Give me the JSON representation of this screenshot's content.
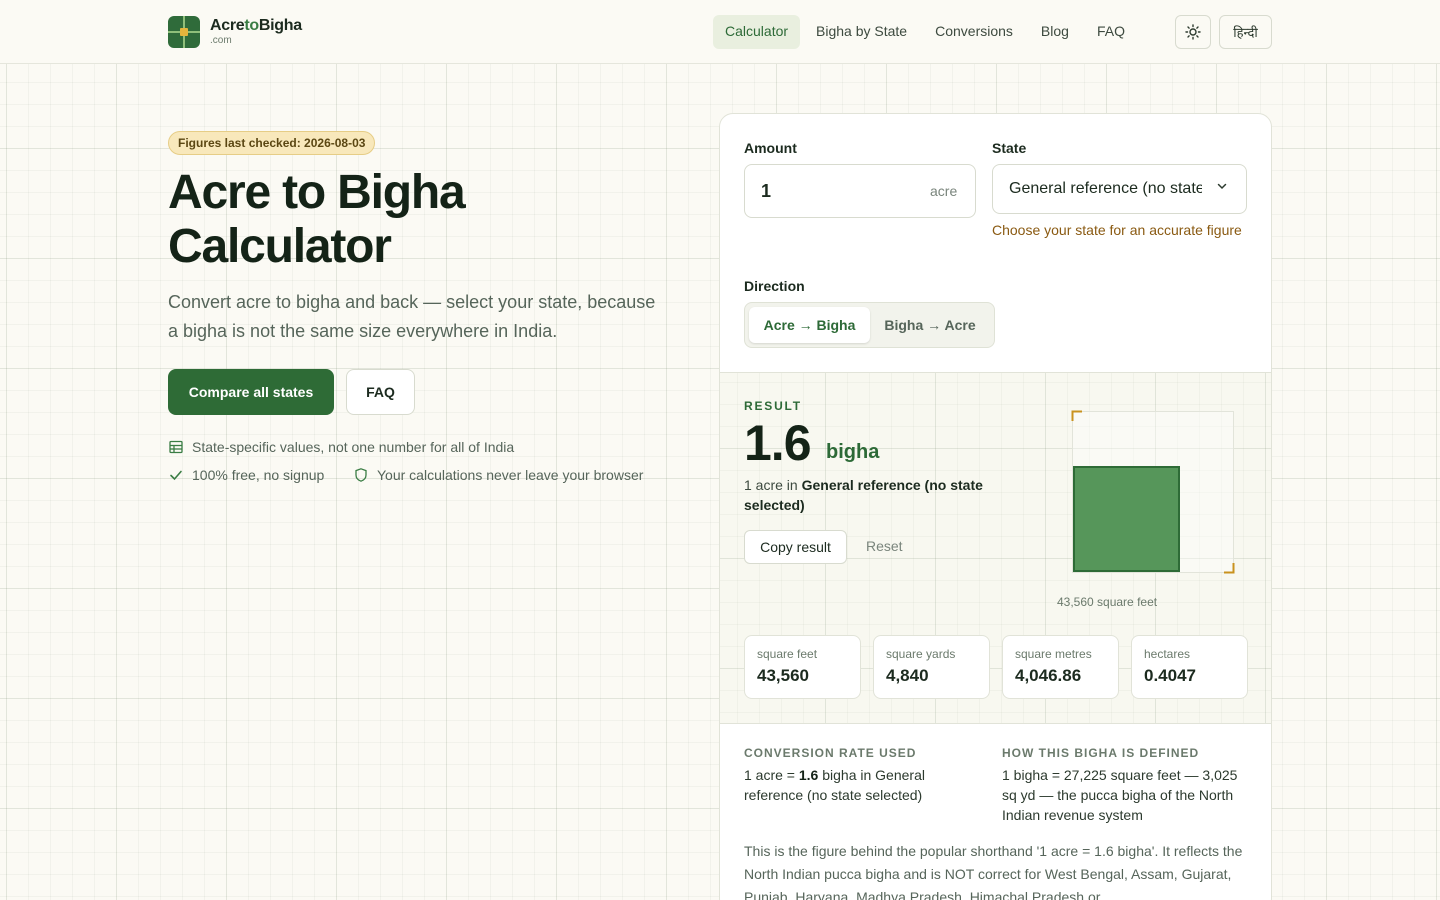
{
  "header": {
    "logo_pre": "Acre",
    "logo_to": "to",
    "logo_post": "Bigha",
    "logo_sub": ".com",
    "nav": [
      "Calculator",
      "Bigha by State",
      "Conversions",
      "Blog",
      "FAQ"
    ],
    "lang": "हिन्दी"
  },
  "hero": {
    "badge": "Figures last checked: 2026-08-03",
    "title": "Acre to Bigha Calculator",
    "subtitle": "Convert acre to bigha and back — select your state, because a bigha is not the same size everywhere in India.",
    "primary_button": "Compare all states",
    "secondary_button": "FAQ",
    "features": [
      "State-specific values, not one number for all of India",
      "100% free, no signup",
      "Your calculations never leave your browser"
    ]
  },
  "calculator": {
    "amount_label": "Amount",
    "amount_value": "1",
    "amount_unit": "acre",
    "state_label": "State",
    "state_value": "General reference (no state selected)",
    "state_hint": "Choose your state for an accurate figure",
    "direction_label": "Direction",
    "direction_options": [
      "Acre → Bigha",
      "Bigha → Acre"
    ]
  },
  "result": {
    "label": "RESULT",
    "value": "1.6",
    "unit": "bigha",
    "desc_prefix": "1 acre in ",
    "desc_state": "General reference (no state selected)",
    "copy_button": "Copy result",
    "reset_button": "Reset",
    "area_caption": "43,560 square feet",
    "stats": [
      {
        "label": "square feet",
        "value": "43,560"
      },
      {
        "label": "square yards",
        "value": "4,840"
      },
      {
        "label": "square metres",
        "value": "4,046.86"
      },
      {
        "label": "hectares",
        "value": "0.4047"
      }
    ]
  },
  "info": {
    "rate_heading": "CONVERSION RATE USED",
    "rate_pre": "1 acre = ",
    "rate_value": "1.6",
    "rate_post": " bigha in General reference (no state selected)",
    "def_heading": "HOW THIS BIGHA IS DEFINED",
    "def_text": "1 bigha = 27,225 square feet — 3,025 sq yd — the pucca bigha of the North Indian revenue system",
    "paragraph": "This is the figure behind the popular shorthand '1 acre = 1.6 bigha'. It reflects the North Indian pucca bigha and is NOT correct for West Bengal, Assam, Gujarat, Punjab, Haryana, Madhya Pradesh, Himachal Pradesh or"
  },
  "colors": {
    "brand": "#2e6b36",
    "accent": "#e3b53c",
    "background": "#fbfaf4"
  }
}
